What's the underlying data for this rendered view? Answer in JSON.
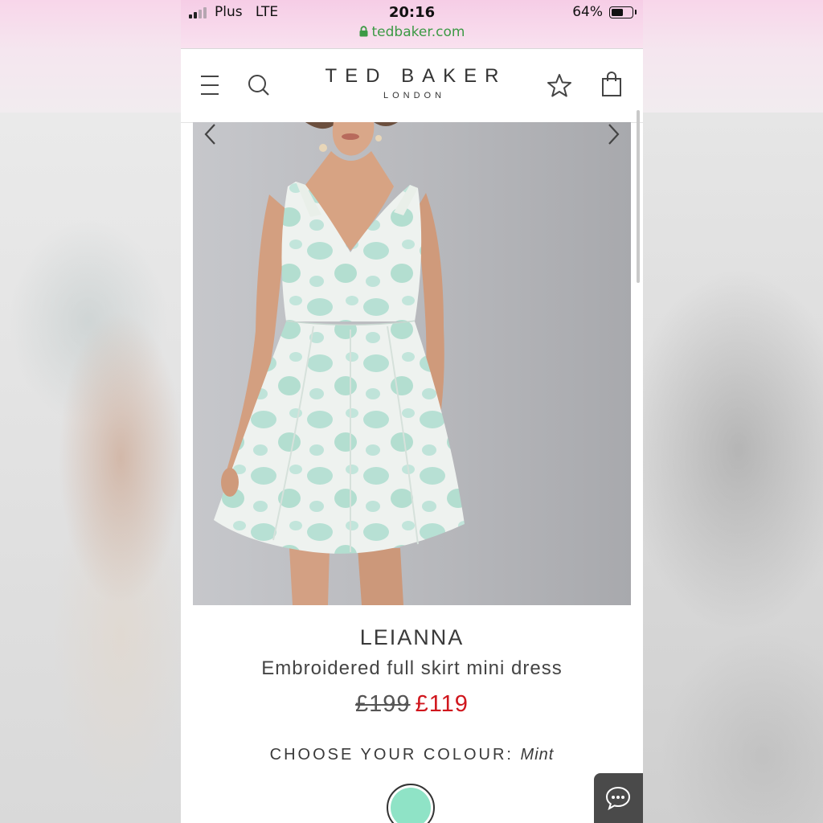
{
  "status_bar": {
    "carrier": "Plus",
    "network": "LTE",
    "time": "20:16",
    "battery": "64%",
    "battery_level": 0.64,
    "url": "tedbaker.com"
  },
  "header": {
    "brand": "TED BAKER",
    "brand_sub": "LONDON",
    "icons": [
      "menu-icon",
      "search-icon",
      "star-icon",
      "shopping-bag-icon"
    ]
  },
  "product": {
    "name": "LEIANNA",
    "description": "Embroidered full skirt mini dress",
    "price_old": "£199",
    "price_new": "£119",
    "colour_label": "CHOOSE YOUR COLOUR:",
    "colour_value": "Mint",
    "swatch_color": "#8fe3c6"
  },
  "colors": {
    "status_bar_bg": "#f6cde6",
    "url_green": "#3c9a45",
    "sale_red": "#d0161d",
    "chat_bg": "#4a4a4a"
  }
}
